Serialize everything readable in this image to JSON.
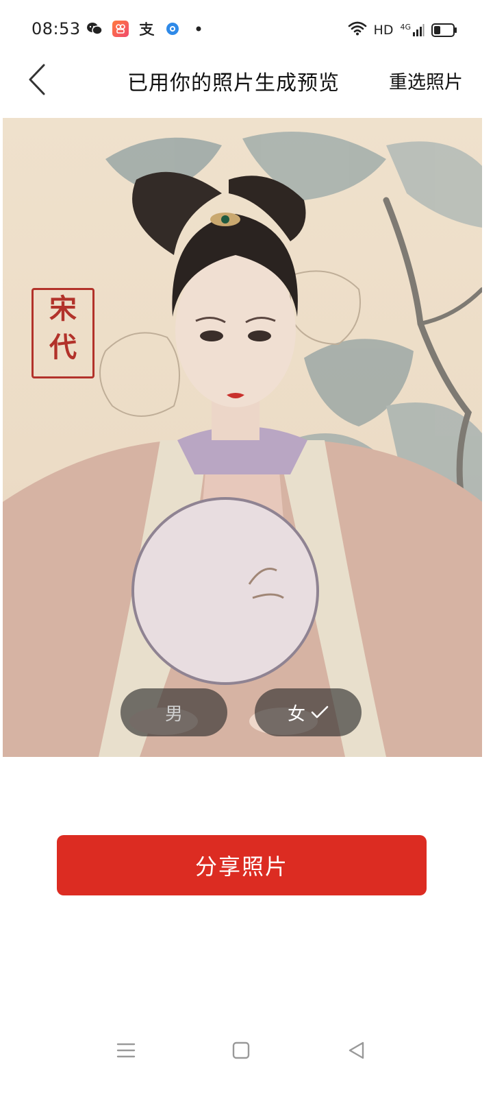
{
  "status": {
    "time": "08:53",
    "network": "HD",
    "signal": "4G",
    "battery_level": 0.35,
    "app_icons": [
      "wechat-icon",
      "kuaishou-icon",
      "alipay-icon",
      "browser-icon",
      "dot-icon"
    ]
  },
  "header": {
    "title": "已用你的照片生成预览",
    "reselect_label": "重选照片"
  },
  "photo": {
    "seal_text": [
      "宋",
      "代"
    ]
  },
  "gender": {
    "male_label": "男",
    "female_label": "女",
    "selected": "female"
  },
  "share": {
    "label": "分享照片"
  },
  "colors": {
    "accent": "#dc2c22"
  }
}
